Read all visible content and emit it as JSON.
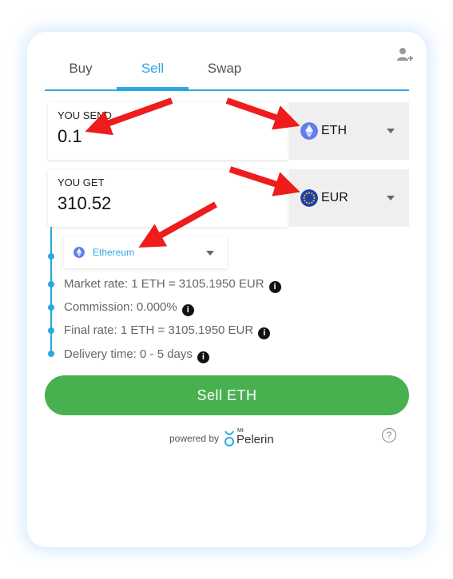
{
  "tabs": [
    {
      "label": "Buy"
    },
    {
      "label": "Sell"
    },
    {
      "label": "Swap"
    }
  ],
  "send": {
    "label": "YOU SEND",
    "value": "0.1",
    "currency": "ETH",
    "icon": "ethereum-icon"
  },
  "get": {
    "label": "YOU GET",
    "value": "310.52",
    "currency": "EUR",
    "icon": "euro-flag-icon"
  },
  "network": {
    "name": "Ethereum",
    "icon": "ethereum-icon"
  },
  "info": {
    "market_rate": "Market rate: 1 ETH = 3105.1950 EUR",
    "commission": "Commission: 0.000%",
    "final_rate": "Final rate: 1 ETH = 3105.1950 EUR",
    "delivery": "Delivery time: 0 - 5 days"
  },
  "sell_button": "Sell ETH",
  "footer": {
    "powered": "powered by",
    "brand_small": "Mt",
    "brand": "Pelerin"
  },
  "colors": {
    "accent": "#2aa9e0",
    "button": "#49b050",
    "arrow": "#ee1c1c"
  }
}
